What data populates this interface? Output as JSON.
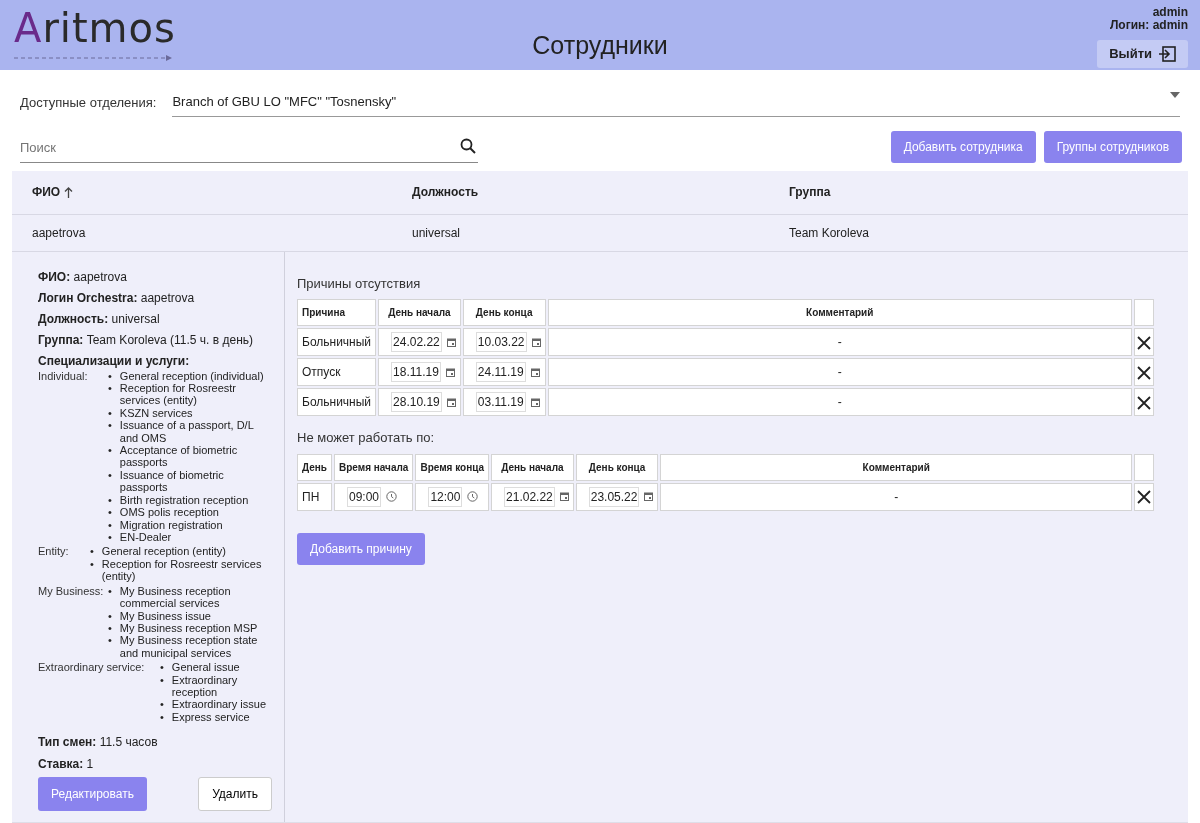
{
  "header": {
    "logo": "Aritmos",
    "title": "Сотрудники",
    "user_name": "admin",
    "login_text": "Логин: admin",
    "logout_label": "Выйти"
  },
  "branch": {
    "label": "Доступные отделения:",
    "value": "Branch of GBU LO \"MFC\" \"Tosnensky\""
  },
  "search": {
    "placeholder": "Поиск"
  },
  "actions": [
    "Добавить сотрудника",
    "Группы сотрудников"
  ],
  "table": {
    "columns": [
      {
        "label": "ФИО",
        "sorted": true
      },
      {
        "label": "Должность",
        "sorted": false
      },
      {
        "label": "Группа",
        "sorted": false
      }
    ],
    "rows": [
      {
        "cells": [
          "aapetrova",
          "universal",
          "Team Koroleva"
        ],
        "expanded": true
      }
    ]
  },
  "details": {
    "fields": [
      {
        "label": "ФИО:",
        "value": "aapetrova"
      },
      {
        "label": "Логин Orchestra:",
        "value": "aapetrova"
      },
      {
        "label": "Должность:",
        "value": "universal"
      },
      {
        "label": "Группа:",
        "value": "Team Koroleva (11.5 ч. в день)"
      }
    ],
    "specializations_title": "Специализации и услуги:",
    "groups": [
      {
        "label": "Individual:",
        "marker": "•",
        "items": [
          "General reception (individual)",
          "Reception for Rosreestr services (entity)",
          "KSZN services",
          "Issuance of a passport, D/L and OMS",
          "Acceptance of biometric passports",
          "Issuance of biometric passports",
          "Birth registration reception",
          "OMS polis reception",
          "Migration registration",
          "EN-Dealer"
        ]
      },
      {
        "label": "Entity:",
        "marker": "•",
        "items": [
          "General reception (entity)",
          "Reception for Rosreestr services (entity)"
        ]
      },
      {
        "label": "My Business:",
        "marker": "•",
        "items": [
          "My Business reception commercial services",
          "My Business issue",
          "My Business reception MSP",
          "My Business reception state and municipal services"
        ]
      },
      {
        "label": "Extraordinary service:",
        "marker": "•",
        "items": [
          "General issue",
          "Extraordinary reception",
          "Extraordinary issue",
          "Express service"
        ]
      }
    ],
    "extra_fields": [
      {
        "label": "Тип смен:",
        "value": "11.5 часов"
      },
      {
        "label": "Ставка:",
        "value": "1"
      }
    ],
    "edit_button": "Редактировать",
    "delete_button": "Удалить"
  },
  "absences": {
    "title": "Причины отсутствия",
    "columns": [
      "Причина",
      "День начала",
      "День конца",
      "Комментарий"
    ],
    "rows": [
      {
        "cells": [
          {
            "kind": "text",
            "value": "Больничный"
          },
          {
            "kind": "date",
            "value": "24.02.22"
          },
          {
            "kind": "date",
            "value": "10.03.22"
          },
          {
            "kind": "comment",
            "value": "-"
          }
        ]
      },
      {
        "cells": [
          {
            "kind": "text",
            "value": "Отпуск"
          },
          {
            "kind": "date",
            "value": "18.11.19"
          },
          {
            "kind": "date",
            "value": "24.11.19"
          },
          {
            "kind": "comment",
            "value": "-"
          }
        ]
      },
      {
        "cells": [
          {
            "kind": "text",
            "value": "Больничный"
          },
          {
            "kind": "date",
            "value": "28.10.19"
          },
          {
            "kind": "date",
            "value": "03.11.19"
          },
          {
            "kind": "comment",
            "value": "-"
          }
        ]
      }
    ]
  },
  "restrictions": {
    "title": "Не может работать по:",
    "columns": [
      "День",
      "Время начала",
      "Время конца",
      "День начала",
      "День конца",
      "Комментарий"
    ],
    "rows": [
      {
        "cells": [
          {
            "kind": "text",
            "value": "ПН"
          },
          {
            "kind": "time",
            "value": "09:00"
          },
          {
            "kind": "time",
            "value": "12:00"
          },
          {
            "kind": "date",
            "value": "21.02.22"
          },
          {
            "kind": "date",
            "value": "23.05.22"
          },
          {
            "kind": "comment",
            "value": "-"
          }
        ]
      }
    ]
  },
  "add_reason_button": "Добавить причину"
}
